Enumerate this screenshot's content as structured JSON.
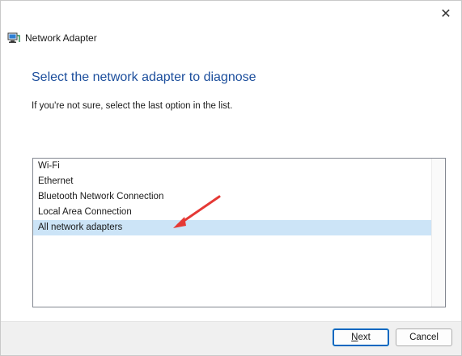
{
  "window": {
    "close_glyph": "✕"
  },
  "header": {
    "title": "Network Adapter",
    "icon": "network-adapter-icon"
  },
  "heading": "Select the network adapter to diagnose",
  "subtext": "If you're not sure, select the last option in the list.",
  "list": {
    "items": [
      {
        "label": "Wi-Fi",
        "selected": false
      },
      {
        "label": "Ethernet",
        "selected": false
      },
      {
        "label": "Bluetooth Network Connection",
        "selected": false
      },
      {
        "label": "Local Area Connection",
        "selected": false
      },
      {
        "label": "All network adapters",
        "selected": true
      }
    ]
  },
  "annotation": {
    "arrow_color": "#e53935"
  },
  "footer": {
    "next_label_first": "N",
    "next_label_rest": "ext",
    "cancel_label": "Cancel"
  },
  "colors": {
    "heading": "#1c4e9c",
    "selection": "#cce4f7",
    "primary_border": "#0067c0"
  }
}
